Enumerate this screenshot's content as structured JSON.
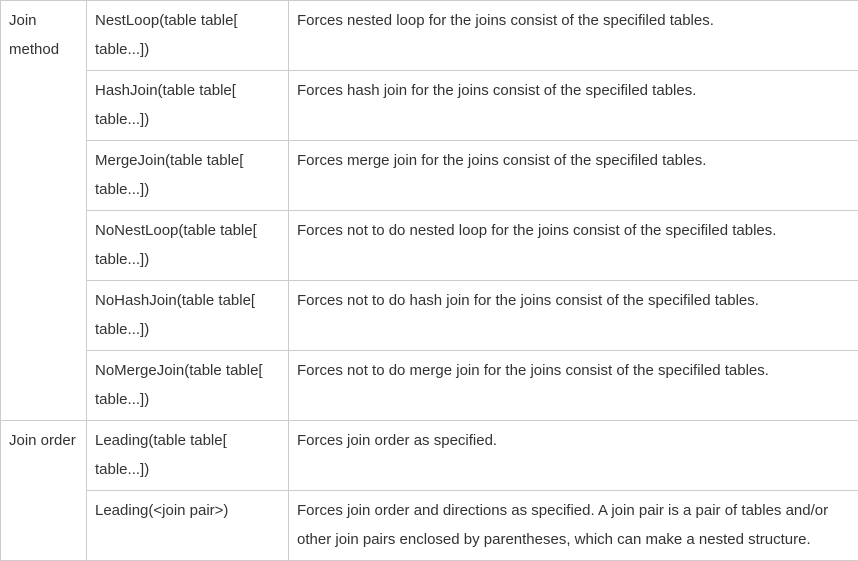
{
  "rows": [
    {
      "category": "Join method",
      "format": "NestLoop(table table[ table...])",
      "desc": "Forces nested loop for the joins consist of the specifiled tables."
    },
    {
      "category": "",
      "format": "HashJoin(table table[ table...])",
      "desc": "Forces hash join for the joins consist of the specifiled tables."
    },
    {
      "category": "",
      "format": "MergeJoin(table table[ table...])",
      "desc": "Forces merge join for the joins consist of the specifiled tables."
    },
    {
      "category": "",
      "format": "NoNestLoop(table table[ table...])",
      "desc": "Forces not to do nested loop for the joins consist of the specifiled tables."
    },
    {
      "category": "",
      "format": "NoHashJoin(table table[ table...])",
      "desc": "Forces not to do hash join for the joins consist of the specifiled tables."
    },
    {
      "category": "",
      "format": "NoMergeJoin(table table[ table...])",
      "desc": "Forces not to do merge join for the joins consist of the specifiled tables."
    },
    {
      "category": "Join order",
      "format": "Leading(table table[ table...])",
      "desc": "Forces join order as specified."
    },
    {
      "category": "",
      "format": "Leading(<join pair>)",
      "desc": "Forces join order and directions as specified. A join pair is a pair of tables and/or other join pairs enclosed by parentheses, which can make a nested structure."
    }
  ],
  "spans": {
    "joinMethod": 6,
    "joinOrder": 2
  }
}
